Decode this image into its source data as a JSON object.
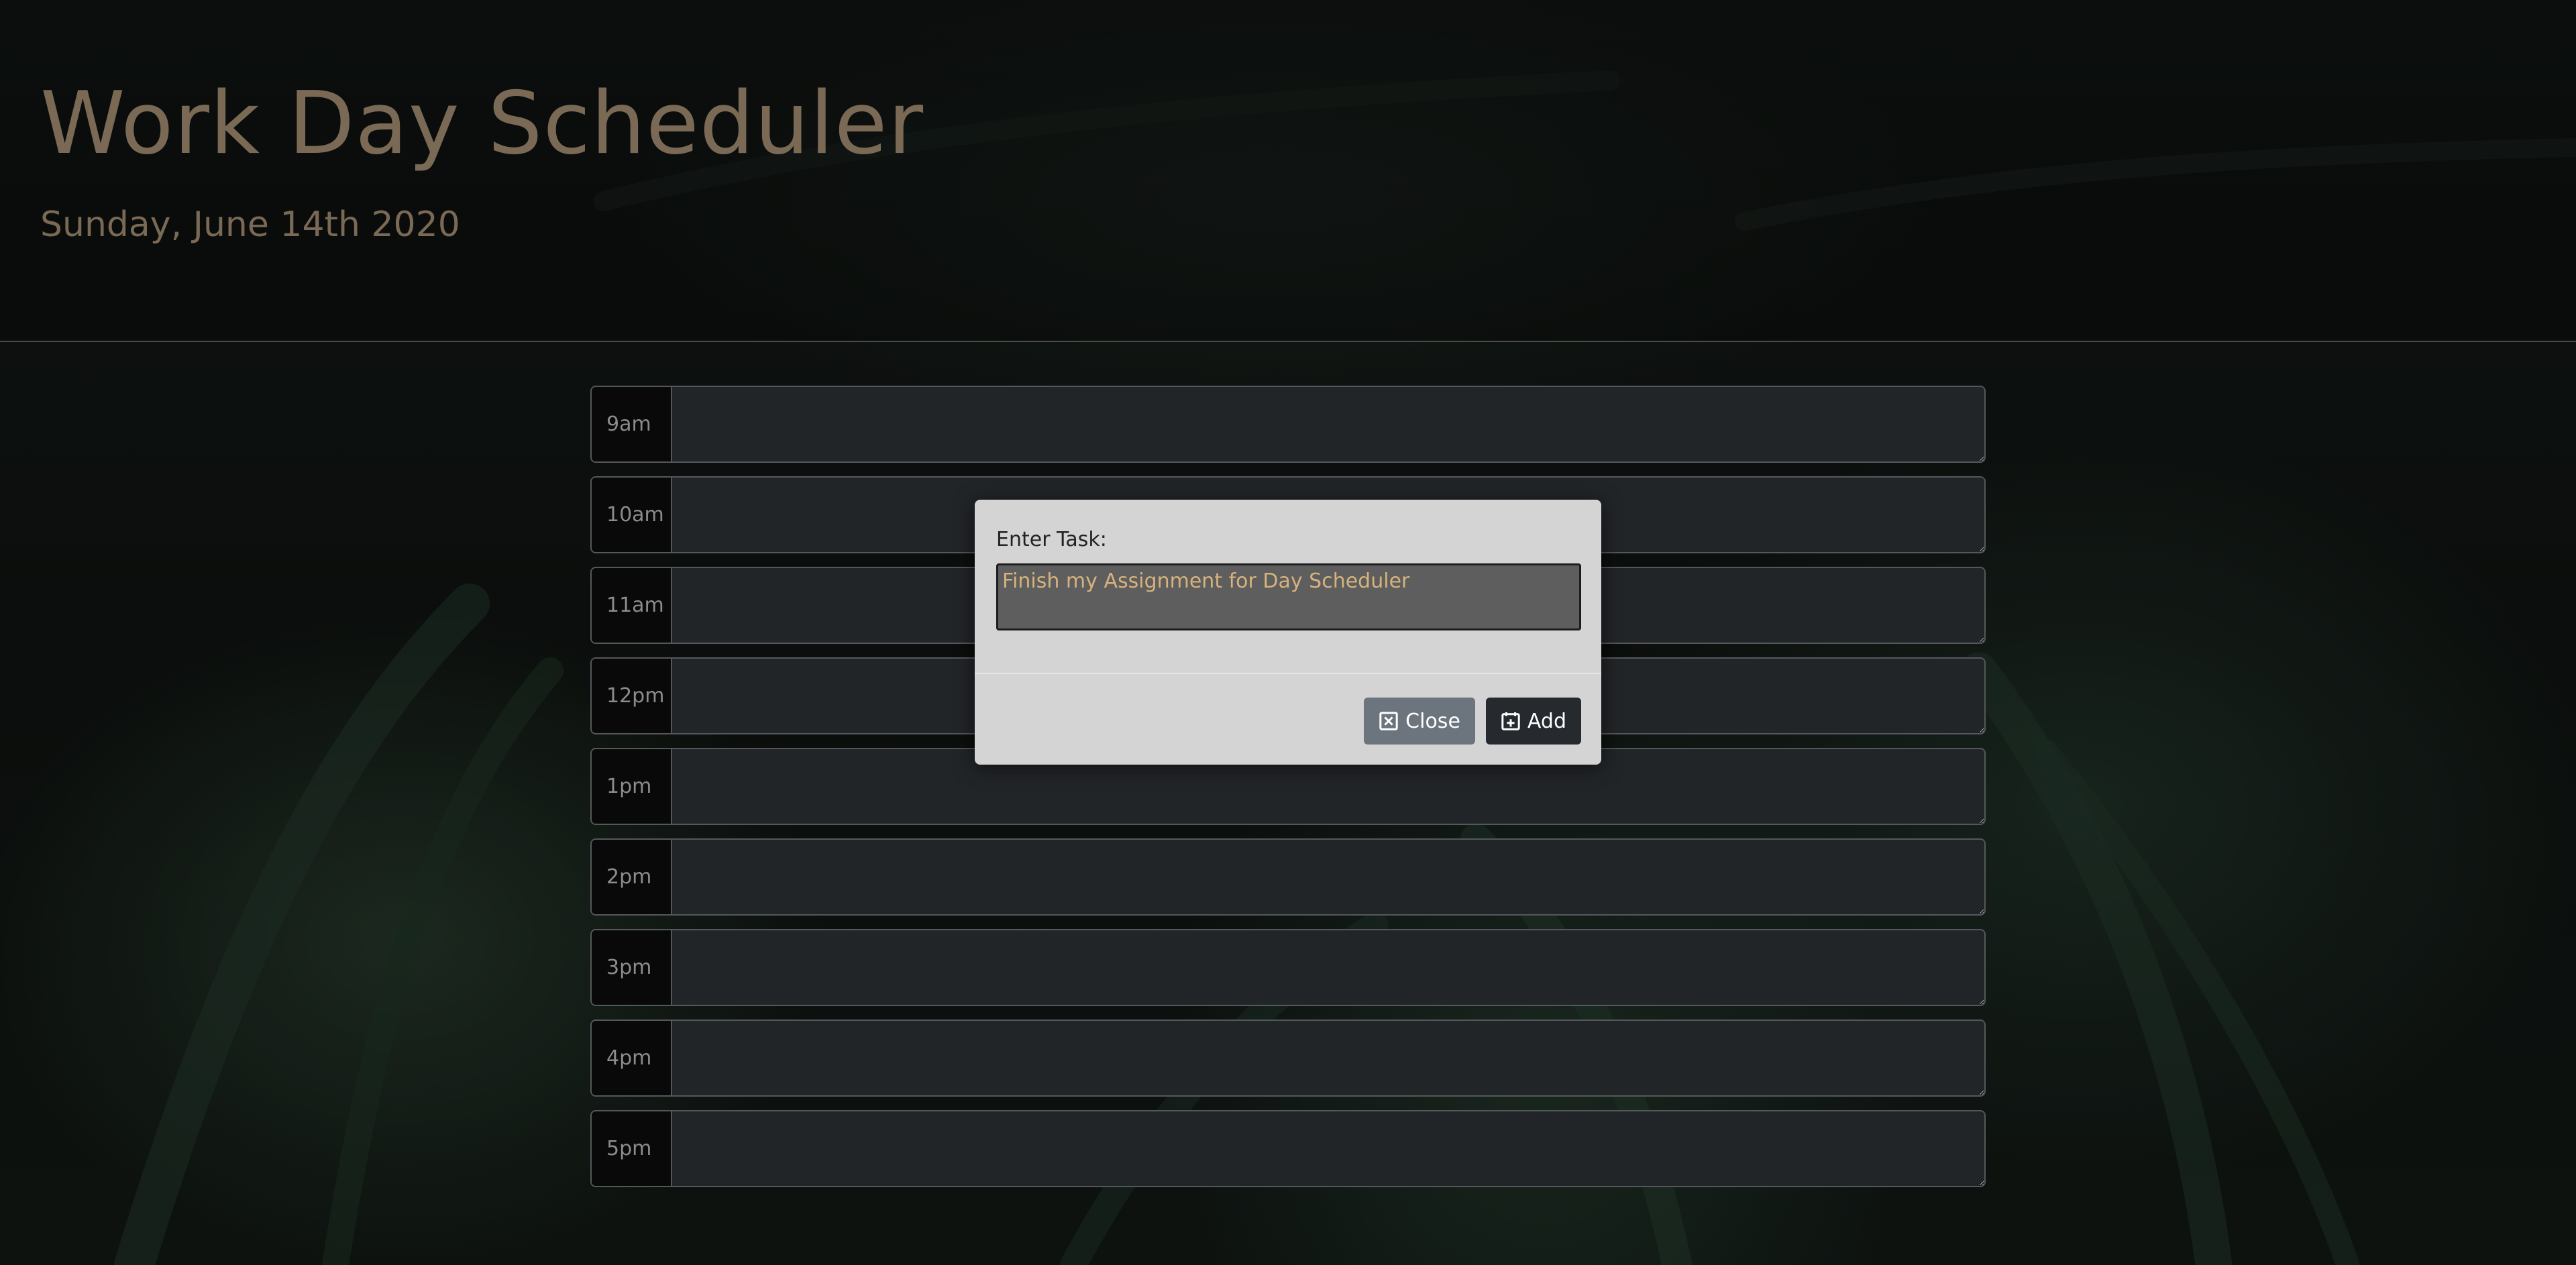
{
  "header": {
    "title": "Work Day Scheduler",
    "date": "Sunday, June 14th 2020"
  },
  "schedule": {
    "hours": [
      {
        "label": "9am",
        "task": ""
      },
      {
        "label": "10am",
        "task": ""
      },
      {
        "label": "11am",
        "task": ""
      },
      {
        "label": "12pm",
        "task": ""
      },
      {
        "label": "1pm",
        "task": ""
      },
      {
        "label": "2pm",
        "task": ""
      },
      {
        "label": "3pm",
        "task": ""
      },
      {
        "label": "4pm",
        "task": ""
      },
      {
        "label": "5pm",
        "task": ""
      }
    ]
  },
  "modal": {
    "label": "Enter Task:",
    "input_value": "Finish my Assignment for Day Scheduler",
    "close_label": "Close",
    "add_label": "Add",
    "close_icon": "close-box-icon",
    "add_icon": "calendar-plus-icon"
  },
  "colors": {
    "title": "#7a6a55",
    "input_text": "#d6b27c",
    "close_button": "#6c757d",
    "add_button": "#262a2e",
    "modal_background": "#d4d4d4"
  }
}
